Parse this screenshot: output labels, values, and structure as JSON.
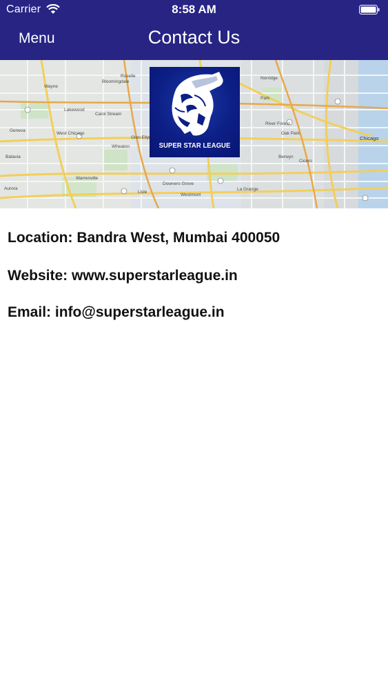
{
  "status_bar": {
    "carrier": "Carrier",
    "time": "8:58 AM"
  },
  "nav": {
    "menu_label": "Menu",
    "title": "Contact Us"
  },
  "banner": {
    "logo_text": "SUPER STAR LEAGUE",
    "map_labels": [
      "Wayne",
      "Roselle",
      "Bloomingdale",
      "Lakewood",
      "Carol Stream",
      "Geneva",
      "West Chicago",
      "Glen Ellyn",
      "Wheaton",
      "Batavia",
      "Warrenville",
      "Aurora",
      "Oak Park",
      "Berwyn",
      "Cicero",
      "Chicago",
      "Westmont",
      "La Grange",
      "Downers Grove",
      "Lisle",
      "River Forest",
      "Norridge",
      "Park"
    ]
  },
  "contact": {
    "location": "Location: Bandra West, Mumbai 400050",
    "website": "Website: www.superstarleague.in",
    "email": "Email: info@superstarleague.in"
  },
  "colors": {
    "nav_background": "#272484",
    "logo_background": "#0d1f86",
    "text": "#111111"
  }
}
